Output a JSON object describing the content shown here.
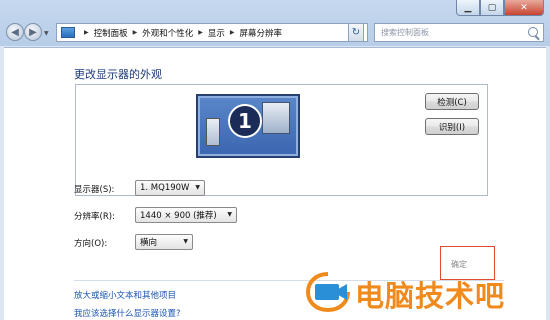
{
  "window": {
    "caption_buttons": [
      "minimize-icon",
      "maximize-icon",
      "close-icon"
    ],
    "close_glyph": "✕"
  },
  "nav": {
    "breadcrumbs": [
      "控制面板",
      "外观和个性化",
      "显示",
      "屏幕分辨率"
    ],
    "search_placeholder": "搜索控制面板"
  },
  "page": {
    "title": "更改显示器的外观",
    "monitor_number": "1",
    "detect_button": "检测(C)",
    "identify_button": "识别(I)"
  },
  "fields": {
    "display_label": "显示器(S):",
    "display_value": "1. MQ190W",
    "resolution_label": "分辨率(R):",
    "resolution_value": "1440 × 900 (推荐)",
    "orientation_label": "方向(O):",
    "orientation_value": "横向"
  },
  "links": {
    "text_size": "放大或缩小文本和其他项目",
    "which_settings": "我应该选择什么显示器设置?"
  },
  "ok_area": {
    "text": "确定"
  },
  "watermark": {
    "text": "电脑技术吧",
    "accent_color": "#f08a1c"
  }
}
